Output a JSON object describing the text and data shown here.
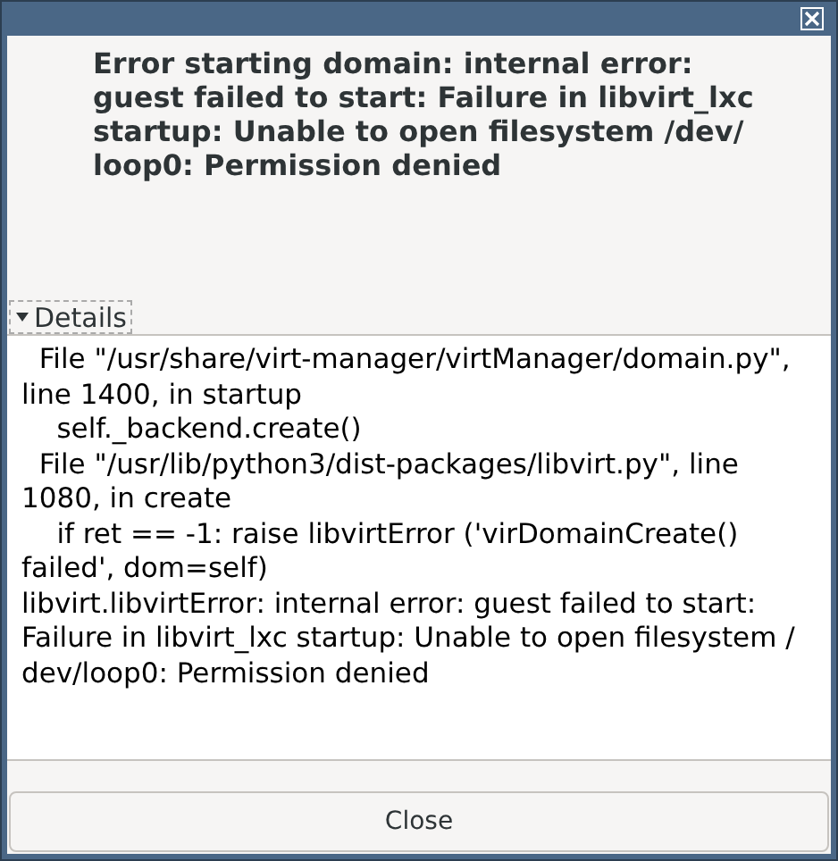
{
  "message": {
    "lines": [
      "Error starting domain: internal error:",
      "guest failed to start: Failure in libvirt_lxc",
      "startup: Unable to open filesystem /dev/",
      "loop0: Permission denied"
    ]
  },
  "details": {
    "label": "Details",
    "expanded": true,
    "lines": [
      "  File \"/usr/share/virt-manager/virtManager/domain.py\",",
      "line 1400, in startup",
      "    self._backend.create()",
      "  File \"/usr/lib/python3/dist-packages/libvirt.py\", line",
      "1080, in create",
      "    if ret == -1: raise libvirtError ('virDomainCreate()",
      "failed', dom=self)",
      "libvirt.libvirtError: internal error: guest failed to start:",
      "Failure in libvirt_lxc startup: Unable to open filesystem /",
      "dev/loop0: Permission denied"
    ]
  },
  "buttons": [
    {
      "label": "Close"
    }
  ]
}
